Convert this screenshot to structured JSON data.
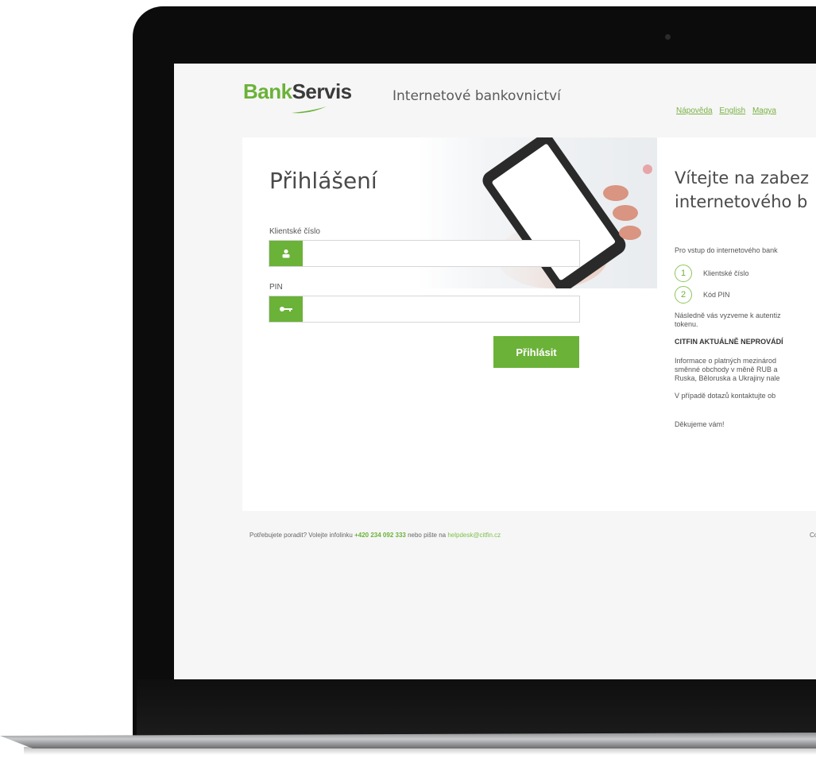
{
  "brand": {
    "logo_part1": "Bank",
    "logo_part2": "Servis",
    "tagline": "Internetové bankovnictví"
  },
  "top_links": [
    "Nápověda",
    "English",
    "Magya"
  ],
  "login": {
    "title": "Přihlášení",
    "client_label": "Klientské číslo",
    "client_value": "",
    "pin_label": "PIN",
    "pin_value": "",
    "submit_label": "Přihlásit"
  },
  "info": {
    "welcome_line1": "Vítejte na zabez",
    "welcome_line2": "internetového b",
    "intro": "Pro vstup do internetového bank",
    "steps": [
      {
        "number": "1",
        "label": "Klientské číslo"
      },
      {
        "number": "2",
        "label": "Kód PIN"
      }
    ],
    "auth_line1": "Následně vás vyzveme k autentiz",
    "auth_line2": "tokenu.",
    "warning": "CITFIN AKTUÁLNĚ NEPROVÁDÍ",
    "notice_line1": "Informace o platných mezinárod",
    "notice_line2": "směnné obchody v měně RUB a",
    "notice_line3": "Ruska, Běloruska a Ukrajiny nale",
    "contact": "V případě dotazů kontaktujte ob",
    "thanks": "Děkujeme vám!"
  },
  "footer": {
    "prefix": "Potřebujete poradit? Volejte infolinku",
    "phone": "+420 234 092 333",
    "middle": "nebo pište na",
    "email": "helpdesk@citfin.cz",
    "right": "Co"
  },
  "colors": {
    "accent": "#6bb238",
    "link": "#79b145",
    "frame": "#0c0c0c",
    "background": "#f6f6f6"
  },
  "icons": {
    "client_field": "user-icon",
    "pin_field": "key-icon"
  }
}
